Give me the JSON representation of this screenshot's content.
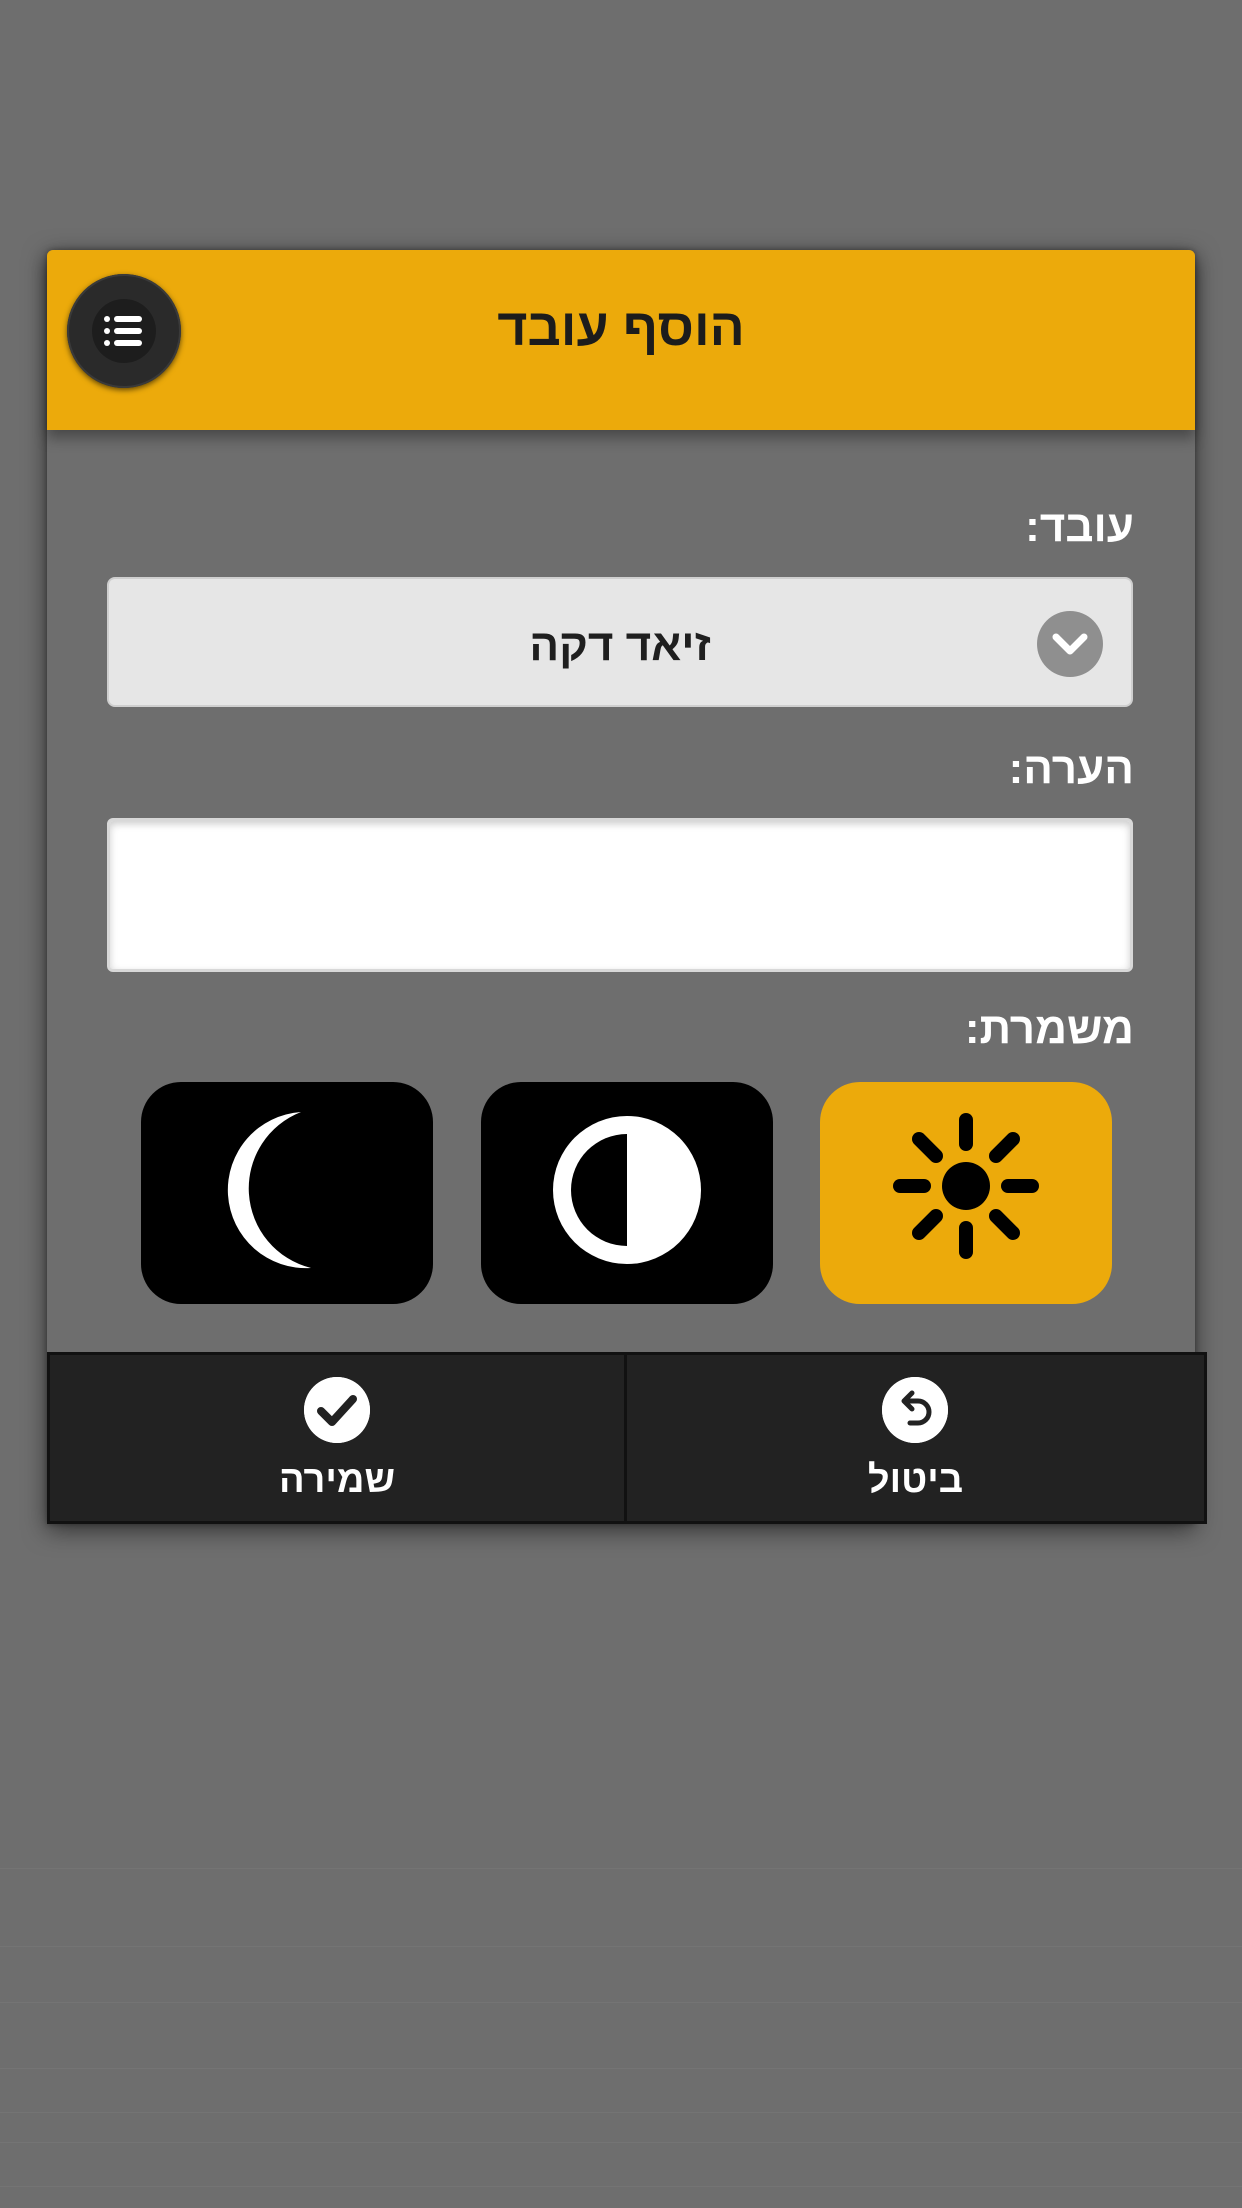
{
  "dialog": {
    "title": "הוסף עובד",
    "menu_icon": "list-icon"
  },
  "form": {
    "employee_label": "עובד:",
    "employee_value": "זיאד דקה",
    "note_label": "הערה:",
    "note_value": "",
    "shift_label": "משמרת:",
    "shifts": [
      {
        "id": "morning",
        "icon": "sun-icon",
        "selected": true
      },
      {
        "id": "evening",
        "icon": "half-circle-icon",
        "selected": false
      },
      {
        "id": "night",
        "icon": "moon-icon",
        "selected": false
      }
    ]
  },
  "footer": {
    "save_label": "שמירה",
    "save_icon": "check-icon",
    "cancel_label": "ביטול",
    "cancel_icon": "undo-icon"
  },
  "colors": {
    "accent": "#ecaa0b",
    "background": "#6e6e6e",
    "footer": "#222222"
  }
}
